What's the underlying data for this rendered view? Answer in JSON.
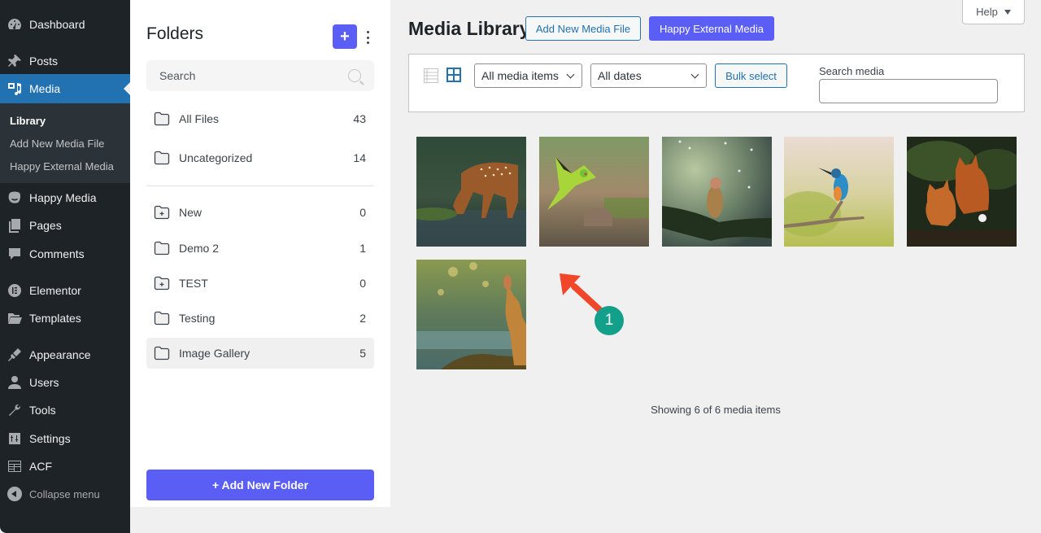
{
  "sidebar": {
    "items": [
      {
        "label": "Dashboard",
        "icon": "dashboard-icon"
      },
      {
        "label": "Posts",
        "icon": "pin-icon"
      },
      {
        "label": "Media",
        "icon": "media-icon",
        "current": true
      },
      {
        "label": "Happy Media",
        "icon": "happy-media-icon"
      },
      {
        "label": "Pages",
        "icon": "pages-icon"
      },
      {
        "label": "Comments",
        "icon": "comment-icon"
      },
      {
        "label": "Elementor",
        "icon": "elementor-icon"
      },
      {
        "label": "Templates",
        "icon": "folder-open-icon"
      },
      {
        "label": "Appearance",
        "icon": "paintbrush-icon"
      },
      {
        "label": "Users",
        "icon": "user-icon"
      },
      {
        "label": "Tools",
        "icon": "wrench-icon"
      },
      {
        "label": "Settings",
        "icon": "settings-icon"
      },
      {
        "label": "ACF",
        "icon": "acf-icon"
      }
    ],
    "submenu": [
      {
        "label": "Library",
        "current": true
      },
      {
        "label": "Add New Media File"
      },
      {
        "label": "Happy External Media"
      }
    ],
    "collapse_label": "Collapse menu"
  },
  "folders": {
    "title": "Folders",
    "add_icon": "+",
    "search_placeholder": "Search",
    "items": [
      {
        "name": "All Files",
        "count": "43",
        "icon": "folder-icon"
      },
      {
        "name": "Uncategorized",
        "count": "14",
        "icon": "folder-icon"
      },
      {
        "name": "New",
        "count": "0",
        "icon": "folder-plus-icon"
      },
      {
        "name": "Demo 2",
        "count": "1",
        "icon": "folder-icon"
      },
      {
        "name": "TEST",
        "count": "0",
        "icon": "folder-plus-icon"
      },
      {
        "name": "Testing",
        "count": "2",
        "icon": "folder-icon"
      },
      {
        "name": "Image Gallery",
        "count": "5",
        "icon": "folder-icon",
        "active": true
      }
    ],
    "add_button_label": "+ Add New Folder"
  },
  "header": {
    "help_label": "Help",
    "page_title": "Media Library",
    "add_new_label": "Add New Media File",
    "happy_external_label": "Happy External Media"
  },
  "toolbar": {
    "filter_type": "All media items",
    "filter_date": "All dates",
    "bulk_select_label": "Bulk select",
    "search_label": "Search media",
    "search_value": ""
  },
  "media": {
    "items": [
      {
        "subject": "Fawn drinking from a forest pond"
      },
      {
        "subject": "Green parakeet landing on a rock"
      },
      {
        "subject": "Small bird on a mossy branch in the rain"
      },
      {
        "subject": "Kingfisher perched on a twig"
      },
      {
        "subject": "Two red foxes in the undergrowth"
      },
      {
        "subject": "Deer in a sunlit forest stream"
      }
    ],
    "showing_text": "Showing 6 of 6 media items"
  },
  "annotation": {
    "badge": "1"
  },
  "colors": {
    "wp_blue": "#2271b1",
    "purple": "#5b5ef4",
    "sidebar_bg": "#1d2327",
    "annotation_arrow": "#f0472a",
    "annotation_badge": "#13a08a"
  }
}
